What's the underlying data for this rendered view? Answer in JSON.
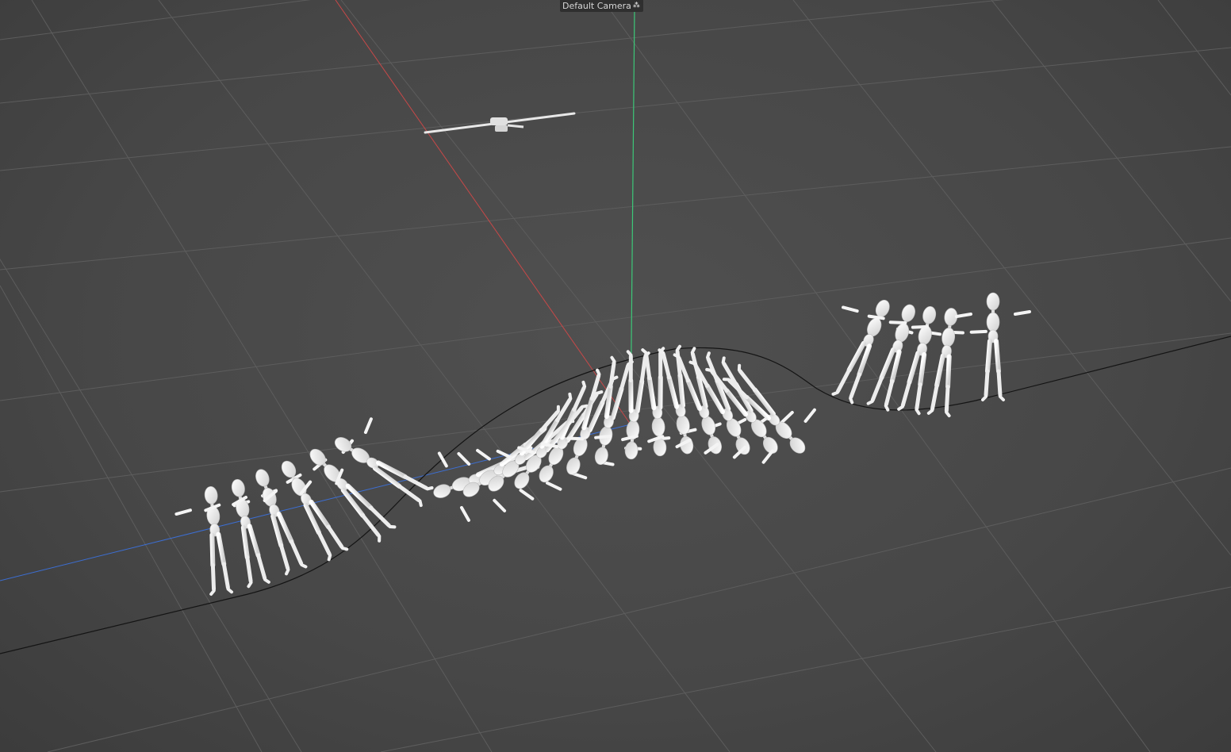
{
  "viewport": {
    "camera_label": "Default Camera",
    "camera_icon": "camera-dots-icon",
    "background_color": "#4a4a4a",
    "grid_color": "#5e5e5e",
    "axis_x_color": "#c84848",
    "axis_y_color": "#3cc878",
    "axis_z_color": "#3c6ed2",
    "spline_color": "#141414",
    "figure_color": "#e8e8e8"
  }
}
